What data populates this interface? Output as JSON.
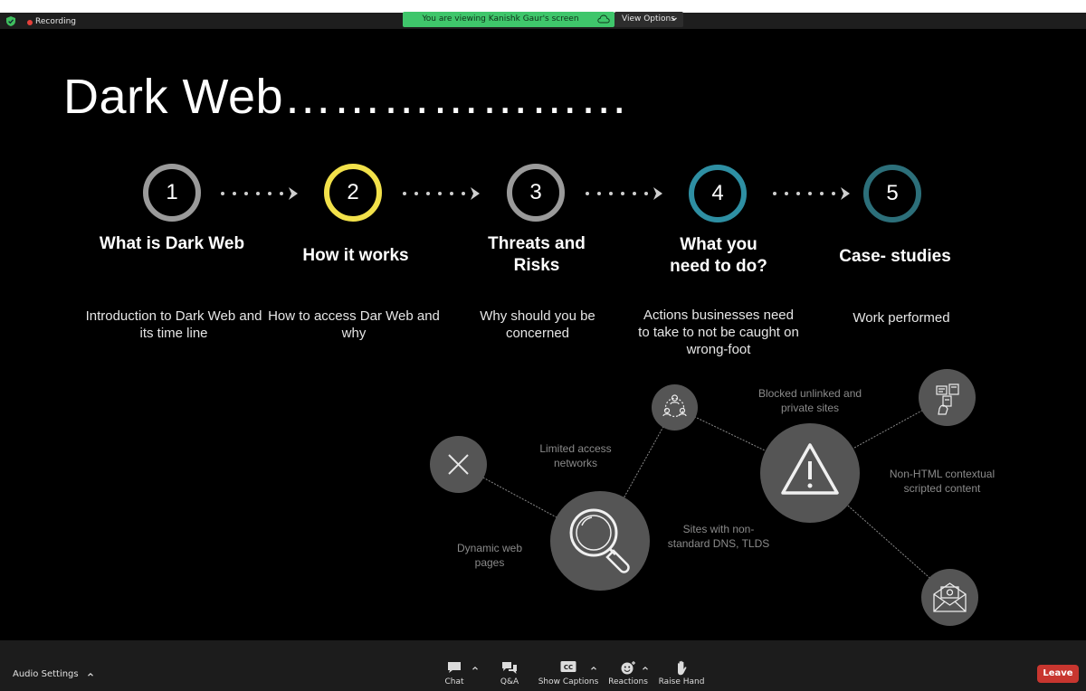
{
  "topbar": {
    "recording_label": "Recording",
    "viewing_banner": "You are viewing Kanishk Gaur's screen",
    "view_options_label": "View Options",
    "recording_color": "#e5403a",
    "banner_color": "#3fc66b"
  },
  "slide": {
    "title": "Dark Web…………………",
    "steps": [
      {
        "number": "1",
        "title": "What is Dark Web",
        "description": "Introduction to Dark Web and its time line",
        "ring_color": "#9a9a9a"
      },
      {
        "number": "2",
        "title": "How it works",
        "description": "How to access Dar Web and why",
        "ring_color": "#f2e14a"
      },
      {
        "number": "3",
        "title": "Threats and Risks",
        "description": "Why should you be concerned",
        "ring_color": "#9a9a9a"
      },
      {
        "number": "4",
        "title": "What you need to do?",
        "description": "Actions businesses need to take to not be caught on wrong-foot",
        "ring_color": "#2e8fa3"
      },
      {
        "number": "5",
        "title": "Case- studies",
        "description": "Work performed",
        "ring_color": "#2c6f7a"
      }
    ],
    "network_labels": {
      "limited_access": "Limited access networks",
      "blocked_unlinked": "Blocked unlinked and private sites",
      "non_html": "Non-HTML contextual scripted content",
      "dynamic_pages": "Dynamic web pages",
      "non_standard_dns": "Sites with non-standard DNS, TLDS"
    },
    "network_icons": [
      "close-icon",
      "magnifier-icon",
      "people-network-icon",
      "warning-icon",
      "devices-icon",
      "email-icon"
    ]
  },
  "toolbar": {
    "audio_settings_label": "Audio Settings",
    "buttons": [
      {
        "label": "Chat",
        "icon": "chat-icon"
      },
      {
        "label": "Q&A",
        "icon": "qa-icon"
      },
      {
        "label": "Show Captions",
        "icon": "cc-icon"
      },
      {
        "label": "Reactions",
        "icon": "reactions-icon"
      },
      {
        "label": "Raise Hand",
        "icon": "raise-hand-icon"
      }
    ],
    "cc_text": "CC",
    "leave_label": "Leave",
    "leave_color": "#c8362f"
  }
}
